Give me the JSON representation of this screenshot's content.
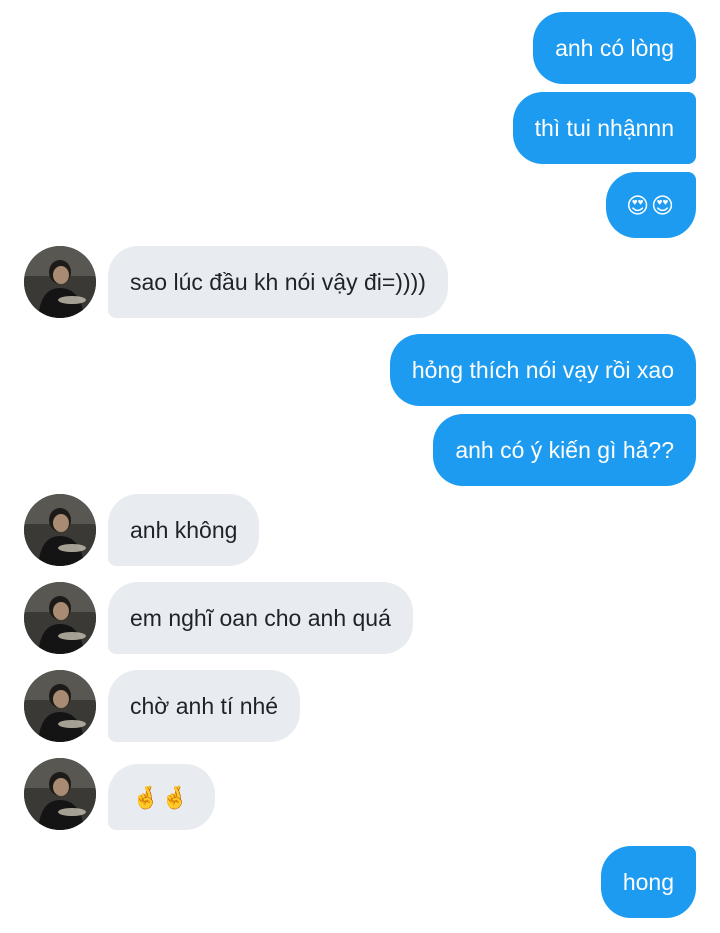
{
  "messages": [
    {
      "side": "out",
      "text": "anh có lòng"
    },
    {
      "side": "out",
      "text": "thì tui nhậnnn"
    },
    {
      "side": "out",
      "text": "😍😍",
      "icon": "heart-eyes-cat-emoji"
    },
    {
      "side": "in",
      "text": "sao lúc đầu kh nói vậy đi=))))"
    },
    {
      "side": "out",
      "text": "hỏng thích nói vạy rồi xao"
    },
    {
      "side": "out",
      "text": "anh có ý kiến gì hả??"
    },
    {
      "side": "in",
      "text": "anh không"
    },
    {
      "side": "in",
      "text": "em nghĩ oan cho anh quá"
    },
    {
      "side": "in",
      "text": "chờ anh tí nhé"
    },
    {
      "side": "in",
      "text": "🤞🤞",
      "icon": "crossed-fingers-emoji"
    },
    {
      "side": "out",
      "text": "hong"
    }
  ],
  "colors": {
    "outgoing_bubble": "#1d9bf0",
    "incoming_bubble": "#e8ecf0",
    "outgoing_text": "#ffffff",
    "incoming_text": "#1f2328"
  },
  "avatar": {
    "icon": "contact-photo-avatar"
  }
}
